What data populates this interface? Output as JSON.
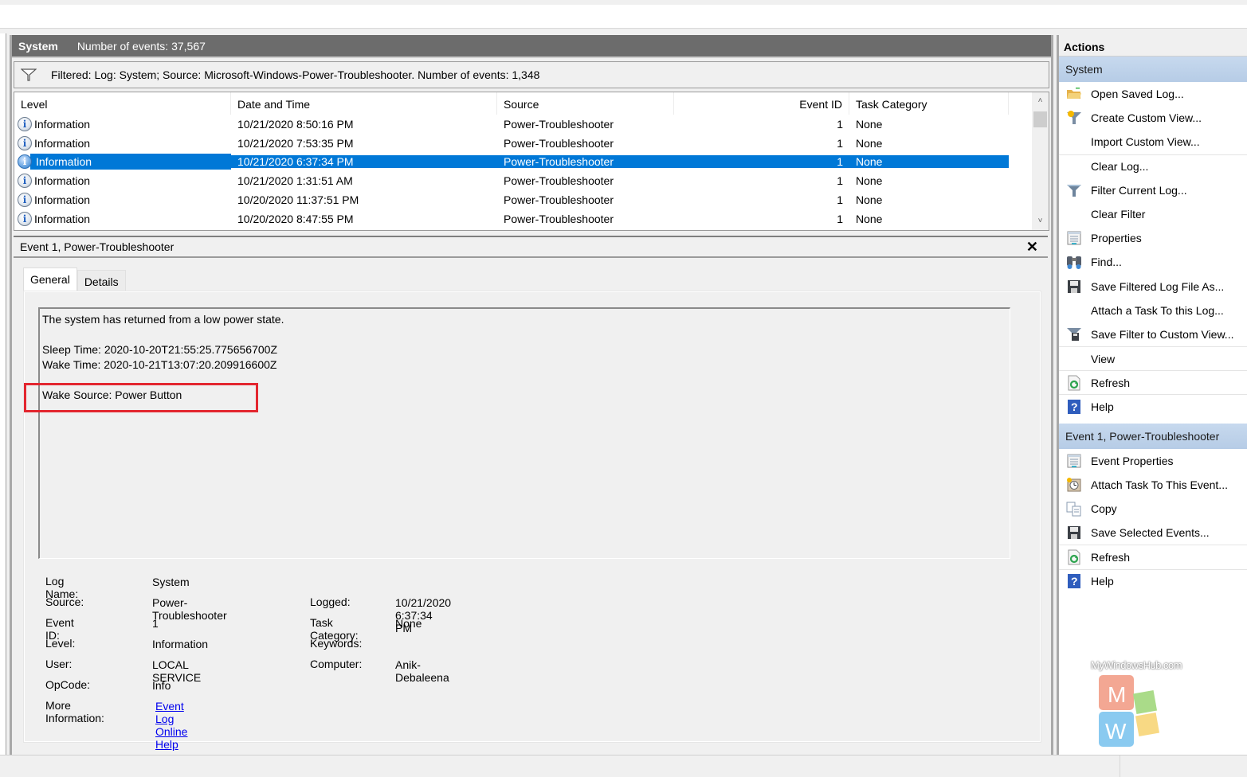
{
  "log_header": {
    "name": "System",
    "count_label": "Number of events: 37,567"
  },
  "filter_bar": {
    "icon": "filter-icon",
    "text": "Filtered: Log: System; Source: Microsoft-Windows-Power-Troubleshooter. Number of events: 1,348"
  },
  "grid": {
    "columns": [
      "Level",
      "Date and Time",
      "Source",
      "Event ID",
      "Task Category"
    ],
    "rows": [
      {
        "level": "Information",
        "date": "10/21/2020 8:50:16 PM",
        "source": "Power-Troubleshooter",
        "id": "1",
        "task": "None"
      },
      {
        "level": "Information",
        "date": "10/21/2020 7:53:35 PM",
        "source": "Power-Troubleshooter",
        "id": "1",
        "task": "None"
      },
      {
        "level": "Information",
        "date": "10/21/2020 6:37:34 PM",
        "source": "Power-Troubleshooter",
        "id": "1",
        "task": "None",
        "selected": true
      },
      {
        "level": "Information",
        "date": "10/21/2020 1:31:51 AM",
        "source": "Power-Troubleshooter",
        "id": "1",
        "task": "None"
      },
      {
        "level": "Information",
        "date": "10/20/2020 11:37:51 PM",
        "source": "Power-Troubleshooter",
        "id": "1",
        "task": "None"
      },
      {
        "level": "Information",
        "date": "10/20/2020 8:47:55 PM",
        "source": "Power-Troubleshooter",
        "id": "1",
        "task": "None"
      }
    ],
    "scroll_up": "^",
    "scroll_down": "v"
  },
  "detail": {
    "title": "Event 1, Power-Troubleshooter",
    "close": "✕",
    "tabs": [
      "General",
      "Details"
    ],
    "active_tab": "General",
    "description": {
      "line1": "The system has returned from a low power state.",
      "line2": "Sleep Time: 2020-10-20T21:55:25.775656700Z",
      "line3": "Wake Time: 2020-10-21T13:07:20.209916600Z",
      "line4": "Wake Source: Power Button"
    },
    "properties": {
      "log_name_label": "Log Name:",
      "log_name": "System",
      "source_label": "Source:",
      "source": "Power-Troubleshooter",
      "logged_label": "Logged:",
      "logged": "10/21/2020 6:37:34 PM",
      "event_id_label": "Event ID:",
      "event_id": "1",
      "task_category_label": "Task Category:",
      "task_category": "None",
      "level_label": "Level:",
      "level": "Information",
      "keywords_label": "Keywords:",
      "keywords": "",
      "user_label": "User:",
      "user": "LOCAL SERVICE",
      "computer_label": "Computer:",
      "computer": "Anik-Debaleena",
      "opcode_label": "OpCode:",
      "opcode": "Info",
      "more_info_label": "More Information:",
      "more_info_link": "Event Log Online Help"
    }
  },
  "actions": {
    "title": "Actions",
    "sections": [
      {
        "header": "System",
        "items": [
          {
            "label": "Open Saved Log...",
            "icon": "folder-open-icon"
          },
          {
            "label": "Create Custom View...",
            "icon": "filter-star-icon"
          },
          {
            "label": "Import Custom View...",
            "icon": ""
          },
          {
            "label": "Clear Log...",
            "icon": "",
            "sep": true
          },
          {
            "label": "Filter Current Log...",
            "icon": "filter-icon"
          },
          {
            "label": "Clear Filter",
            "icon": ""
          },
          {
            "label": "Properties",
            "icon": "properties-icon"
          },
          {
            "label": "Find...",
            "icon": "binoculars-icon"
          },
          {
            "label": "Save Filtered Log File As...",
            "icon": "floppy-disk-icon"
          },
          {
            "label": "Attach a Task To this Log...",
            "icon": ""
          },
          {
            "label": "Save Filter to Custom View...",
            "icon": "save-filter-icon"
          },
          {
            "label": "View",
            "icon": "",
            "sep": true
          },
          {
            "label": "Refresh",
            "icon": "refresh-icon",
            "sep": true
          },
          {
            "label": "Help",
            "icon": "help-icon",
            "sep": true
          }
        ]
      },
      {
        "header": "Event 1, Power-Troubleshooter",
        "items": [
          {
            "label": "Event Properties",
            "icon": "properties-icon"
          },
          {
            "label": "Attach Task To This Event...",
            "icon": "task-clock-icon"
          },
          {
            "label": "Copy",
            "icon": "copy-icon"
          },
          {
            "label": "Save Selected Events...",
            "icon": "floppy-disk-icon"
          },
          {
            "label": "Refresh",
            "icon": "refresh-icon",
            "sep": true
          },
          {
            "label": "Help",
            "icon": "help-icon",
            "sep": true
          }
        ]
      }
    ]
  },
  "watermark": {
    "text": "MyWindowsHub.com",
    "letters": [
      "M",
      "W"
    ]
  },
  "colors": {
    "selection": "#0078d7",
    "header_bar": "#6c6c6c",
    "section_header": "#bcd1e9",
    "highlight_box": "#e3262f",
    "link": "#0000ee"
  }
}
